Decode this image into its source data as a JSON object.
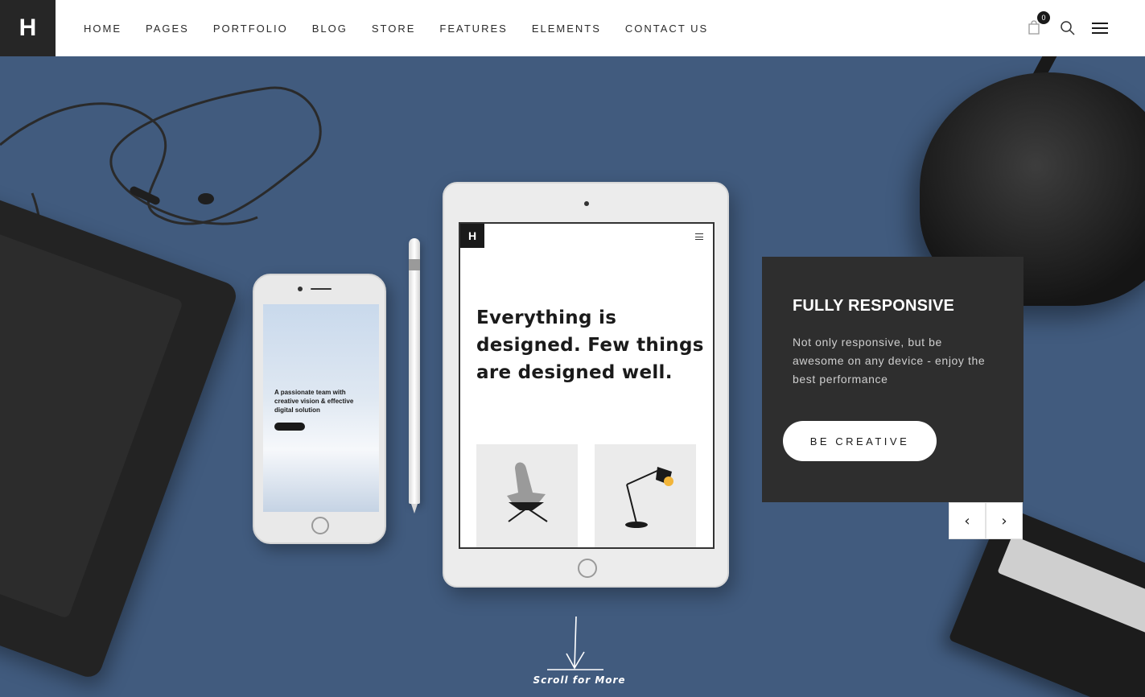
{
  "brand": {
    "logo_letter": "H"
  },
  "nav": {
    "items": [
      "HOME",
      "PAGES",
      "PORTFOLIO",
      "BLOG",
      "STORE",
      "FEATURES",
      "ELEMENTS",
      "CONTACT US"
    ]
  },
  "header": {
    "cart_count": "0",
    "icons": [
      "shopping-bag-icon",
      "search-icon",
      "hamburger-menu-icon"
    ]
  },
  "hero": {
    "phone_screen": {
      "text": "A passionate team with creative vision & effective digital solution"
    },
    "ipad_screen": {
      "logo_letter": "H",
      "heading": "Everything is designed. Few things are designed well."
    },
    "slide": {
      "title": "FULLY RESPONSIVE",
      "description": "Not only responsive, but be awesome on any device - enjoy the best performance",
      "cta_label": "BE CREATIVE",
      "prev_arrow": "‹",
      "next_arrow": "›"
    },
    "scroll_label": "Scroll for More"
  },
  "colors": {
    "hero_bg": "#415b7e",
    "caption_bg": "#2e2e2e",
    "logo_bg": "#262626"
  }
}
